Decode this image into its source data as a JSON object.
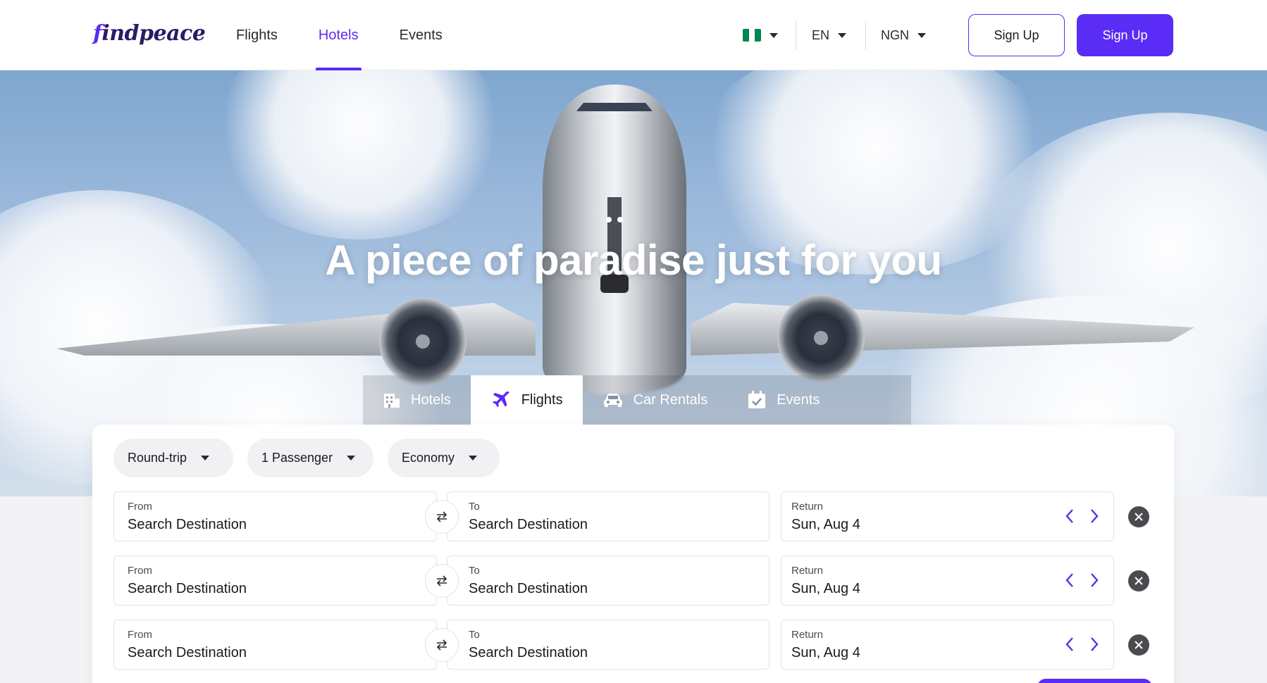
{
  "header": {
    "logo_prefix": "f",
    "logo_rest": "indpeace",
    "nav": [
      {
        "label": "Flights",
        "active": false
      },
      {
        "label": "Hotels",
        "active": true
      },
      {
        "label": "Events",
        "active": false
      }
    ],
    "country_flag_icon": "nigeria-flag-icon",
    "flag_colors": [
      "#008751",
      "#ffffff",
      "#008751"
    ],
    "language": "EN",
    "currency": "NGN",
    "signup_outline_label": "Sign Up",
    "signup_primary_label": "Sign Up"
  },
  "hero": {
    "title": "A piece of paradise just for you"
  },
  "search_tabs": [
    {
      "label": "Hotels",
      "icon": "hotel-building-icon",
      "active": false
    },
    {
      "label": "Flights",
      "icon": "airplane-icon",
      "active": true
    },
    {
      "label": "Car Rentals",
      "icon": "car-icon",
      "active": false
    },
    {
      "label": "Events",
      "icon": "calendar-check-icon",
      "active": false
    }
  ],
  "filters": {
    "trip_type": "Round-trip",
    "passengers": "1 Passenger",
    "cabin": "Economy"
  },
  "legs": [
    {
      "from_label": "From",
      "from_value": "Search Destination",
      "to_label": "To",
      "to_value": "Search Destination",
      "return_label": "Return",
      "return_value": "Sun, Aug 4"
    },
    {
      "from_label": "From",
      "from_value": "Search Destination",
      "to_label": "To",
      "to_value": "Search Destination",
      "return_label": "Return",
      "return_value": "Sun, Aug 4"
    },
    {
      "from_label": "From",
      "from_value": "Search Destination",
      "to_label": "To",
      "to_value": "Search Destination",
      "return_label": "Return",
      "return_value": "Sun, Aug 4"
    }
  ],
  "colors": {
    "brand": "#5b2cf5",
    "dark_brand": "#2b1a66"
  }
}
